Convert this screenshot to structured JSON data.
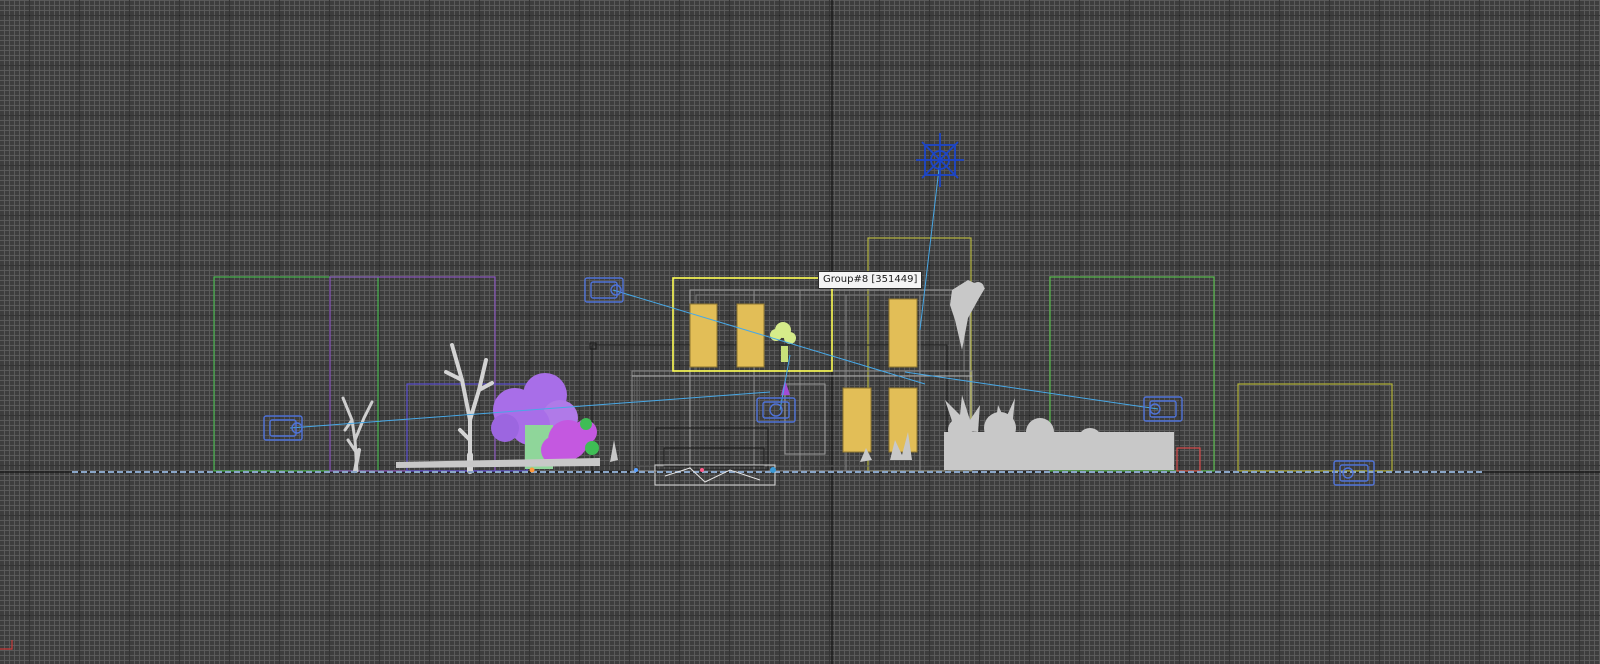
{
  "viewport": {
    "view": "front",
    "grid_visible": true,
    "colors": {
      "background": "#3d3d3d",
      "grid_minor": "#5c5c5c",
      "grid_major": "#2a2a2a",
      "world_axis": "#111111",
      "selection": "#ffff55",
      "window_glass": "#e2be57",
      "camera": "#4f73d9",
      "sun": "#1c45c8",
      "target_line": "#48a8e6",
      "vegetation": "#c8c8c8",
      "shrub_purple": "#a86ee8",
      "shrub_magenta": "#c458e0",
      "red_box": "#d84a4a"
    }
  },
  "tooltip": {
    "text": "Group#8 [351449]"
  },
  "scene_objects": [
    {
      "name": "house-group",
      "type": "group",
      "selected": true
    },
    {
      "name": "sun-light",
      "type": "light",
      "icon": "sun-icon"
    },
    {
      "name": "camera-left",
      "type": "camera",
      "icon": "camera-icon"
    },
    {
      "name": "camera-upper-left",
      "type": "camera",
      "icon": "camera-icon"
    },
    {
      "name": "camera-center",
      "type": "camera",
      "icon": "camera-icon"
    },
    {
      "name": "camera-right",
      "type": "camera",
      "icon": "camera-icon"
    },
    {
      "name": "camera-ground-right",
      "type": "camera",
      "icon": "camera-icon"
    }
  ]
}
